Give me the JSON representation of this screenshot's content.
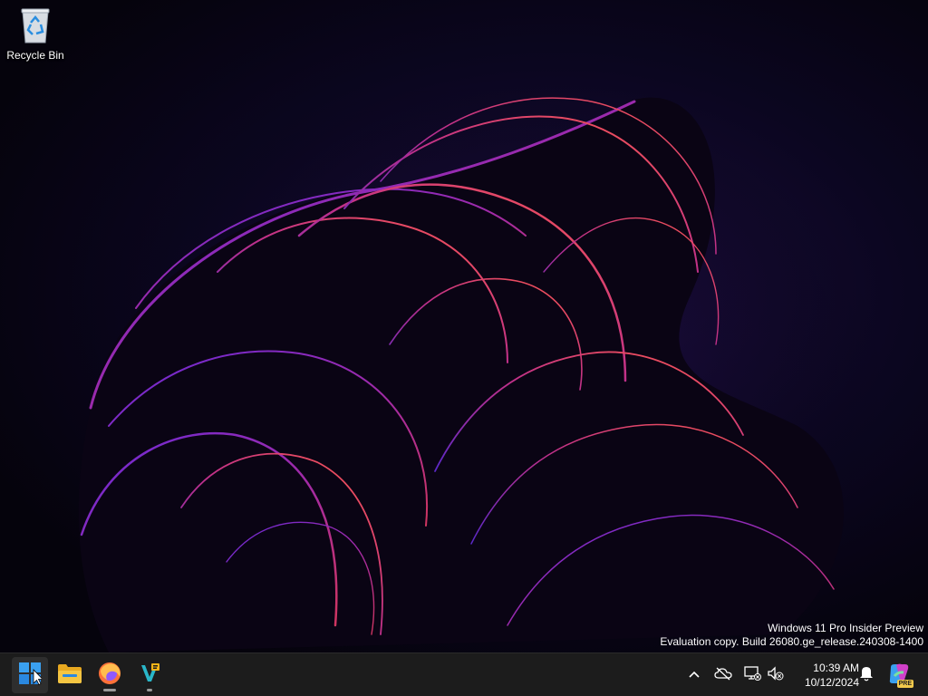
{
  "desktop": {
    "icons": [
      {
        "label": "Recycle Bin",
        "icon": "recycle-bin-icon"
      }
    ],
    "watermark": {
      "line1": "Windows 11 Pro Insider Preview",
      "line2": "Evaluation copy. Build 26080.ge_release.240308-1400"
    }
  },
  "taskbar": {
    "apps": [
      {
        "name": "Start",
        "icon": "windows-start-icon",
        "active": true
      },
      {
        "name": "File Explorer",
        "icon": "folder-icon",
        "active": false
      },
      {
        "name": "Firefox",
        "icon": "firefox-icon",
        "active": false,
        "running": true
      },
      {
        "name": "Visual Studio Code",
        "icon": "vscode-icon",
        "active": false,
        "running": true
      }
    ],
    "tray": {
      "icons": [
        "chevron-up-icon",
        "onedrive-offline-icon",
        "network-icon",
        "volume-muted-icon"
      ],
      "clock": {
        "time": "10:39 AM",
        "date": "10/12/2024"
      },
      "notifications_icon": "bell-icon",
      "copilot_icon": "copilot-pre-icon",
      "copilot_badge": "PRE"
    }
  },
  "colors": {
    "taskbar_bg": "#1c1c1c",
    "wallpaper_accent_purple": "#7a2ad0",
    "wallpaper_accent_magenta": "#d0306a"
  }
}
